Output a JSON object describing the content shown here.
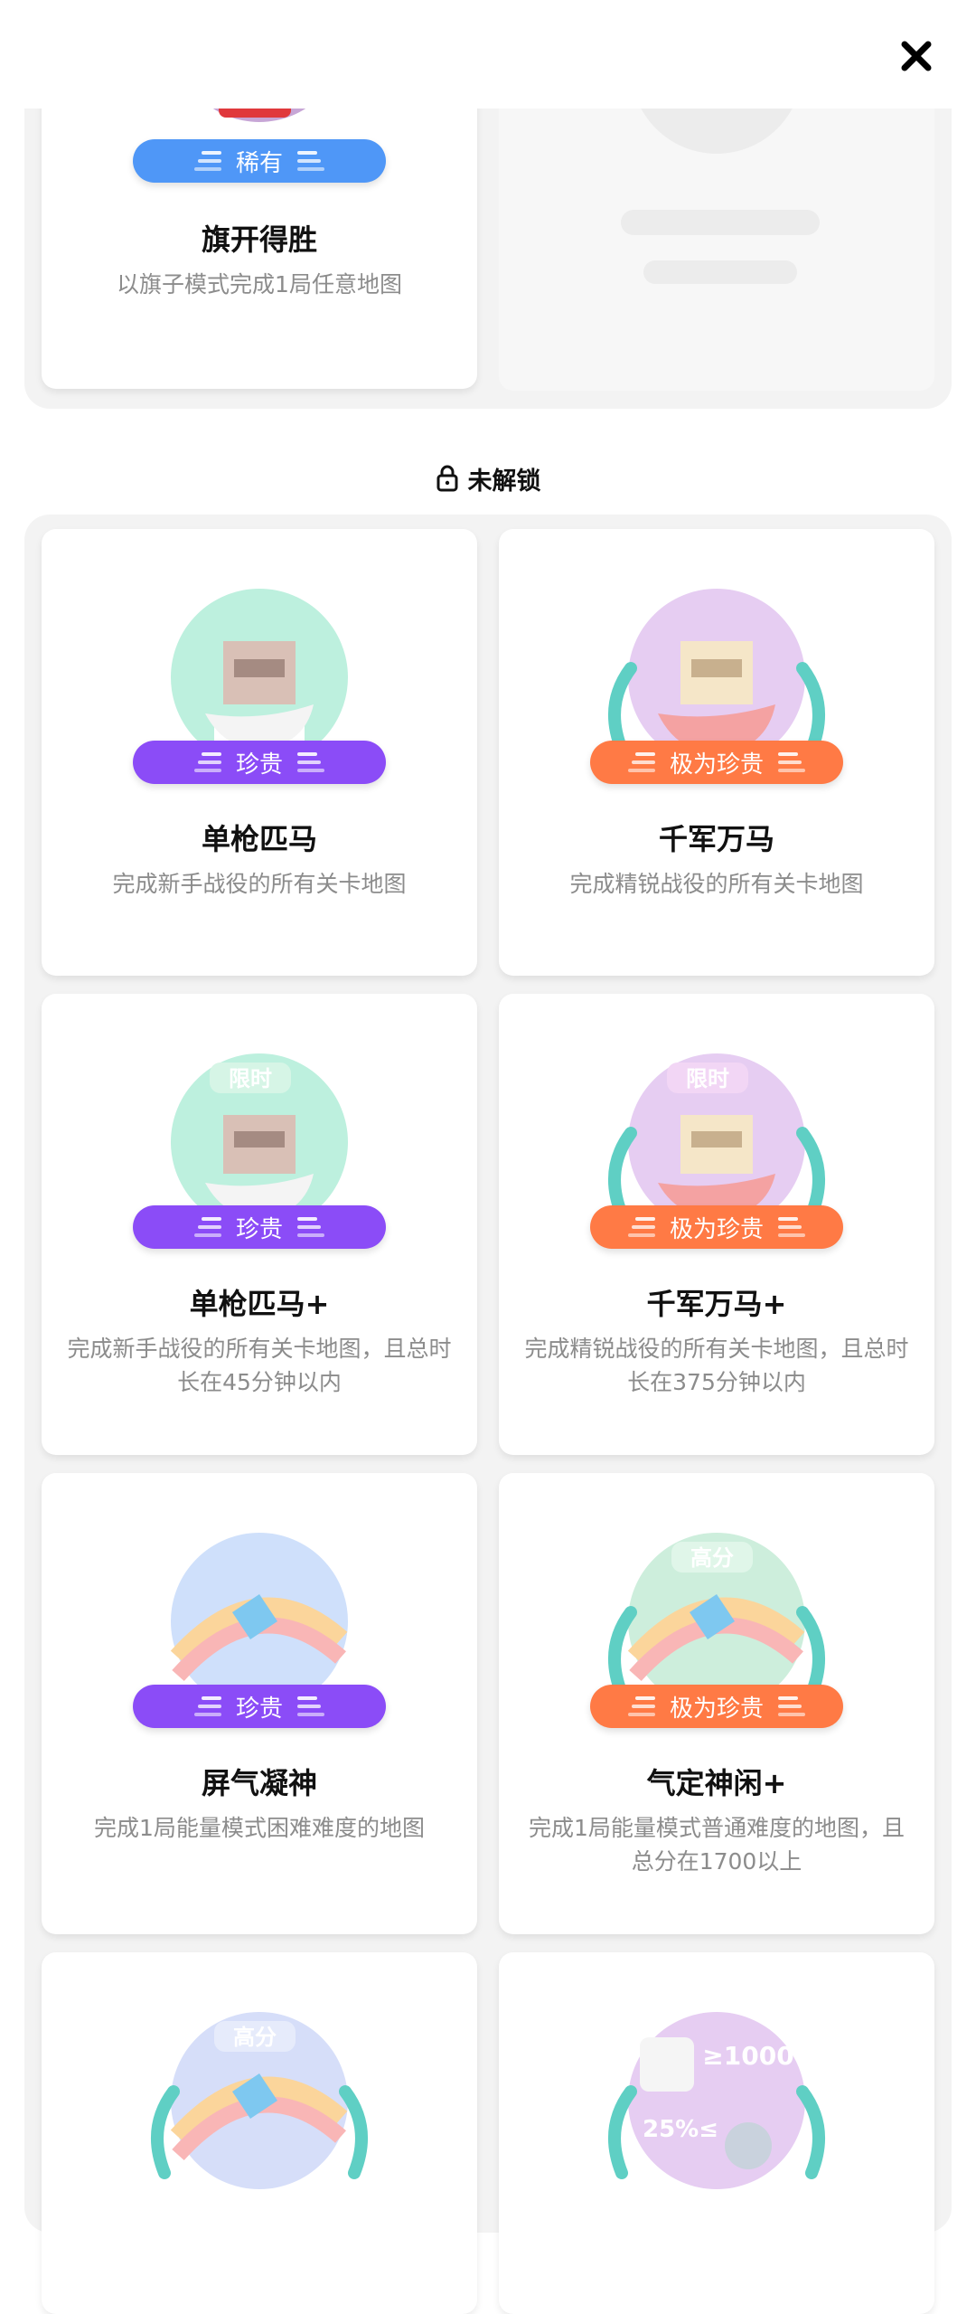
{
  "header": {
    "close_icon": "close-icon"
  },
  "unlocked_section": {
    "cards": [
      {
        "title": "旗开得胜",
        "desc": "以旗子模式完成1局任意地图",
        "rarity": "稀有",
        "rarity_color": "#4f97f7"
      }
    ]
  },
  "locked_section": {
    "label": "未解锁",
    "icon": "lock-icon",
    "cards": [
      {
        "title": "单枪匹马",
        "desc": "完成新手战役的所有关卡地图",
        "rarity": "珍贵",
        "rarity_color": "#8b4cf7"
      },
      {
        "title": "千军万马",
        "desc": "完成精锐战役的所有关卡地图",
        "rarity": "极为珍贵",
        "rarity_color": "#ff7a45"
      },
      {
        "title": "单枪匹马+",
        "desc": "完成新手战役的所有关卡地图，且总时长在45分钟以内",
        "rarity": "珍贵",
        "rarity_color": "#8b4cf7",
        "art_label": "限时"
      },
      {
        "title": "千军万马+",
        "desc": "完成精锐战役的所有关卡地图，且总时长在375分钟以内",
        "rarity": "极为珍贵",
        "rarity_color": "#ff7a45",
        "art_label": "限时"
      },
      {
        "title": "屏气凝神",
        "desc": "完成1局能量模式困难难度的地图",
        "rarity": "珍贵",
        "rarity_color": "#8b4cf7"
      },
      {
        "title": "气定神闲+",
        "desc": "完成1局能量模式普通难度的地图，且总分在1700以上",
        "rarity": "极为珍贵",
        "rarity_color": "#ff7a45",
        "art_label": "高分"
      },
      {
        "art_label": "高分"
      },
      {
        "art_label": "≥1000",
        "art_label2": "25%≤"
      }
    ]
  }
}
